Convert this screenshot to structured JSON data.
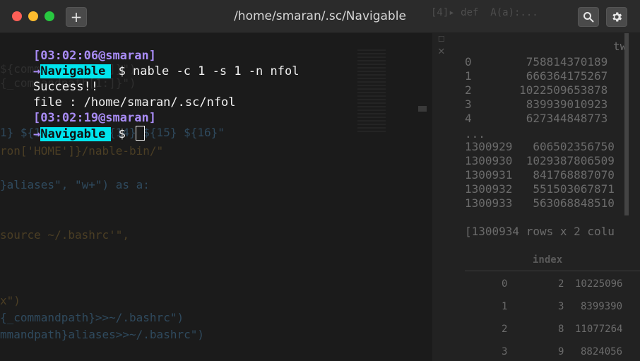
{
  "window": {
    "title": "/home/smaran/.sc/Navigable",
    "new_tab_label": "+",
    "colors": {
      "prompt_timestamp": "#a98cf6",
      "dir_badge_bg": "#00e5ee",
      "close": "#fd5f57",
      "minimize": "#febc2e",
      "maximize": "#28c840"
    }
  },
  "terminal": {
    "line1_timestamp": "[03:02:06@smaran]",
    "line2_arrow": "→",
    "line2_dir": "Navigable",
    "line2_prompt": " $ ",
    "line2_command": "nable -c 1 -s 1 -n nfol",
    "line3_output": "Success!!",
    "line4_output": "file : /home/smaran/.sc/nfol",
    "line5_timestamp": "[03:02:19@smaran]",
    "line6_arrow": "→",
    "line6_dir": "Navigable",
    "line6_prompt": " $ "
  },
  "background_editor": {
    "lines": [
      "${commandpath[1:]}\")",
      "{_commandpath[1:]}\")",
      "1} ${12} ${13} ${14} ${15} ${16}\"",
      "ron['HOME']}/nable-bin/\"",
      "}aliases\", \"w+\") as a:",
      "source ~/.bashrc'\",",
      "x\")",
      "{_commandpath}>>~/.bashrc\")",
      "mmandpath}aliases>>~/.bashrc\")"
    ]
  },
  "background_right": {
    "top_snippet": "[4]▸ def  A(a):...",
    "col_header": "tw",
    "rows": [
      {
        "idx": "0",
        "val": "758814370189"
      },
      {
        "idx": "1",
        "val": "666364175267"
      },
      {
        "idx": "2",
        "val": "1022509653878"
      },
      {
        "idx": "3",
        "val": "839939010923"
      },
      {
        "idx": "4",
        "val": "627344848773"
      },
      {
        "idx": "...",
        "val": ""
      },
      {
        "idx": "1300929",
        "val": "606502356750"
      },
      {
        "idx": "1300930",
        "val": "1029387806509"
      },
      {
        "idx": "1300931",
        "val": "841768887070"
      },
      {
        "idx": "1300932",
        "val": "551503067871"
      },
      {
        "idx": "1300933",
        "val": "563068848510"
      }
    ],
    "shape_text": "[1300934 rows x 2 colu",
    "table_header": "index",
    "table_rows": [
      {
        "row": "0",
        "index": "2",
        "val": "10225096"
      },
      {
        "row": "1",
        "index": "3",
        "val": "8399390"
      },
      {
        "row": "2",
        "index": "8",
        "val": "11077264"
      },
      {
        "row": "3",
        "index": "9",
        "val": "8824056"
      }
    ]
  }
}
